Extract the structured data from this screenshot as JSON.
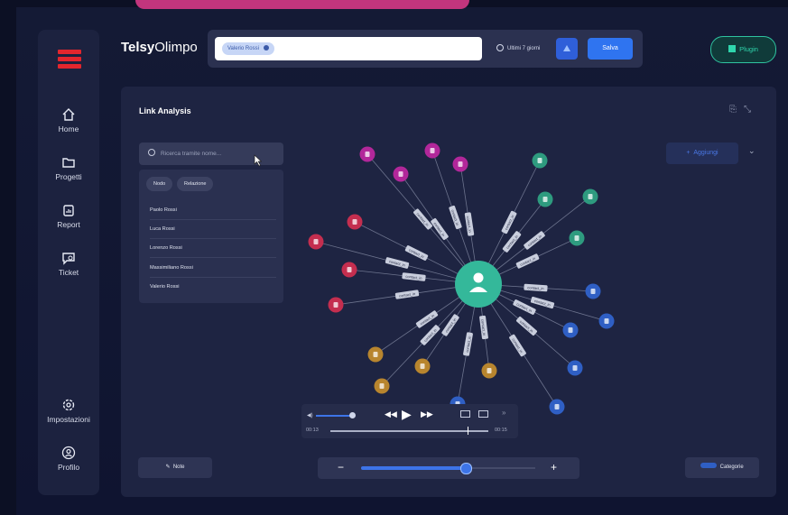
{
  "app": {
    "brand_bold": "Telsy",
    "brand_regular": "Olimpo"
  },
  "sidebar": {
    "items": [
      {
        "label": "Home",
        "icon": "home-icon"
      },
      {
        "label": "Progetti",
        "icon": "folder-icon"
      },
      {
        "label": "Report",
        "icon": "report-icon"
      },
      {
        "label": "Ticket",
        "icon": "ticket-icon"
      },
      {
        "label": "Impostazioni",
        "icon": "gear-icon"
      },
      {
        "label": "Profilo",
        "icon": "user-icon"
      }
    ]
  },
  "topbar": {
    "search_chip": "Valerio Rossi",
    "period": "Ultimi 7 giorni",
    "save_label": "Salva",
    "plugin_label": "Plugin"
  },
  "panel": {
    "title": "Link Analysis",
    "search_placeholder": "Ricerca tramite nome...",
    "filters": [
      "Nodo",
      "Relazione"
    ],
    "results": [
      "Paolo Rossi",
      "Luca Rossi",
      "Lorenzo Rossi",
      "Massimiliano Rossi",
      "Valerio Rossi"
    ],
    "add_label": "Aggiungi",
    "edge_label": "contact_in",
    "colors": {
      "center": "#34b89a",
      "pink": "#b2279a",
      "red": "#c42e4f",
      "green": "#2e9b7f",
      "blue": "#2f5fc4",
      "amber": "#b8852e"
    }
  },
  "video": {
    "current_time": "00:13",
    "total_time": "00:15"
  },
  "bottom": {
    "note_label": "Note",
    "category_label": "Categorie",
    "zoom_level": 0.6
  }
}
